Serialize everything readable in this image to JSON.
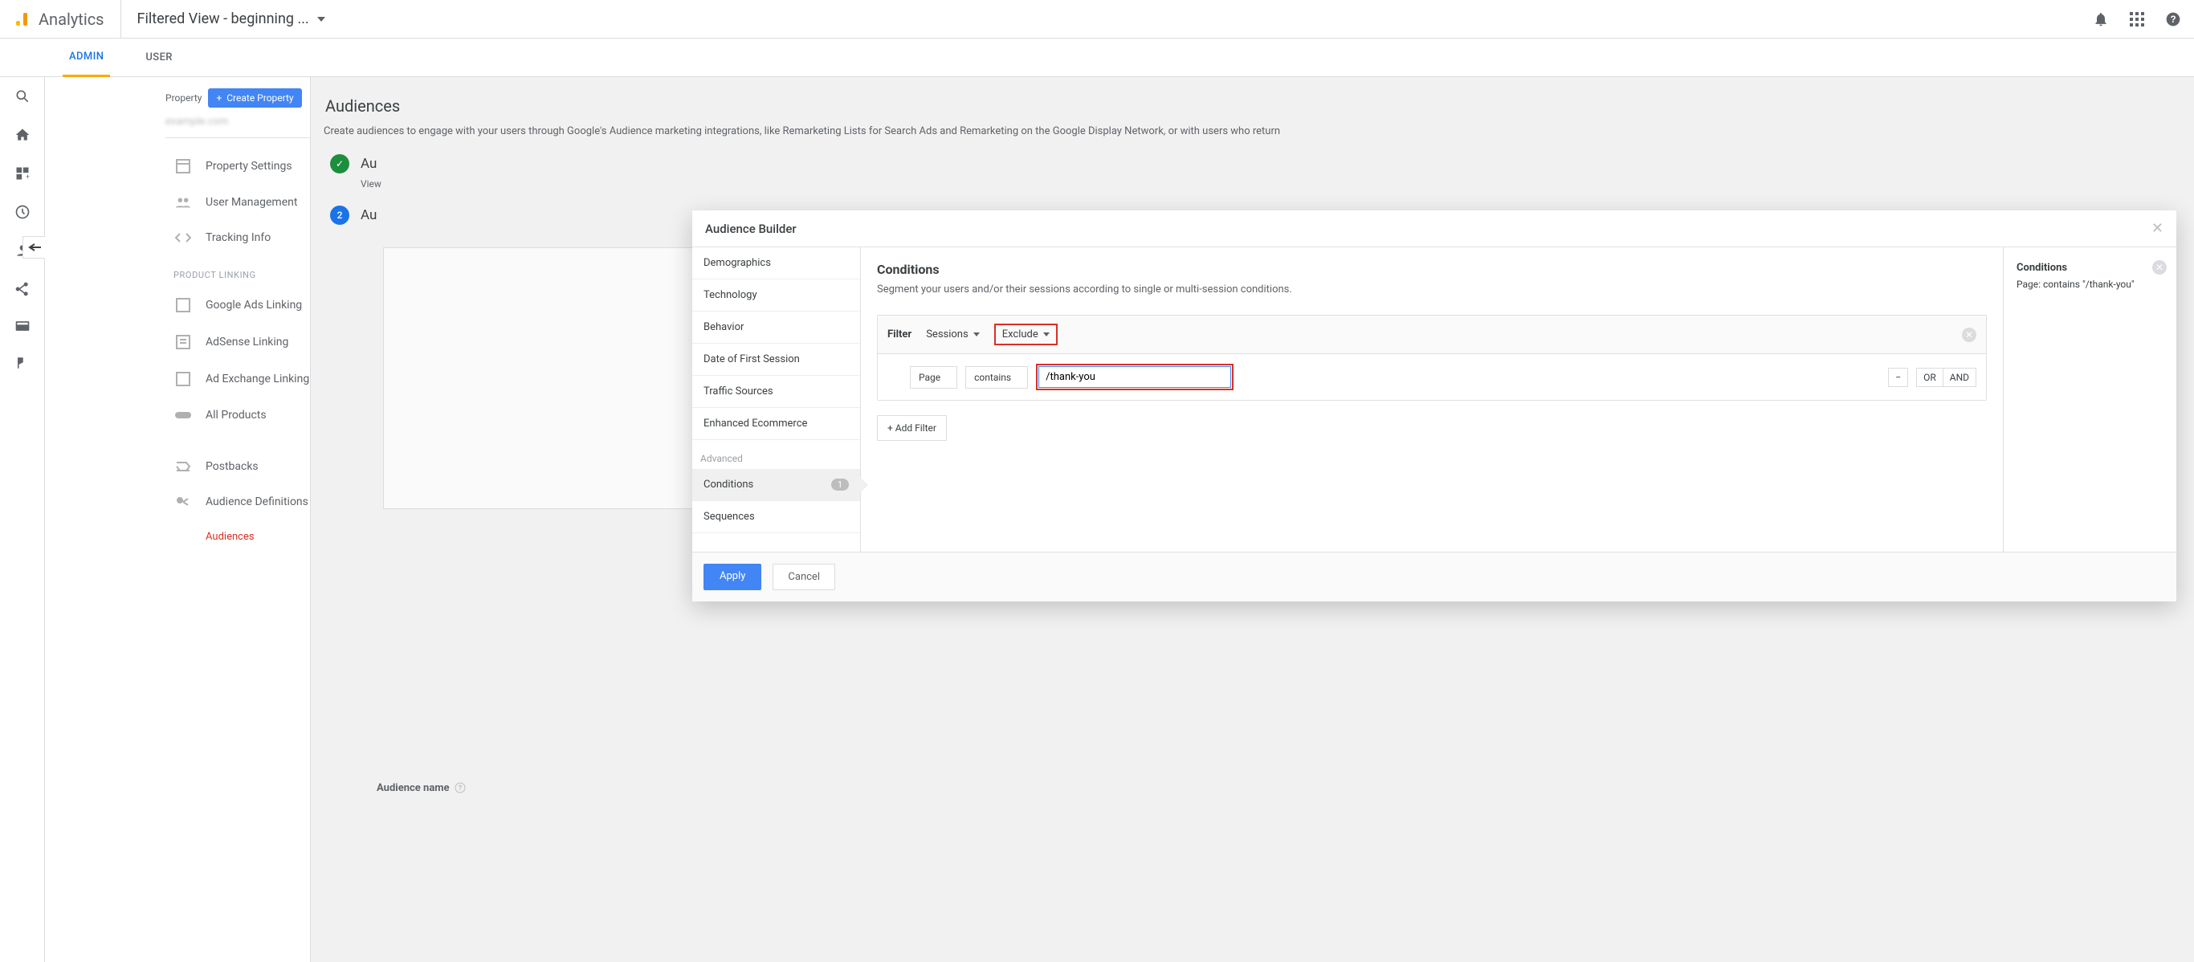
{
  "header": {
    "product": "Analytics",
    "view_title": "Filtered View - beginning ..."
  },
  "tabs": {
    "admin": "ADMIN",
    "user": "USER"
  },
  "property": {
    "label": "Property",
    "create_button": "Create Property",
    "name": "example.com"
  },
  "nav": {
    "property_settings": "Property Settings",
    "user_management": "User Management",
    "tracking_info": "Tracking Info",
    "section_product_linking": "PRODUCT LINKING",
    "google_ads_linking": "Google Ads Linking",
    "adsense_linking": "AdSense Linking",
    "ad_exchange_linking": "Ad Exchange Linking",
    "all_products": "All Products",
    "postbacks": "Postbacks",
    "audience_definitions": "Audience Definitions",
    "audiences_sub": "Audiences"
  },
  "main": {
    "title": "Audiences",
    "description": "Create audiences to engage with your users through Google's Audience marketing integrations, like Remarketing Lists for Search Ads and Remarketing on the Google Display Network, or with users who return",
    "step1": "Au",
    "step1_sub": "View",
    "step2": "Au",
    "audience_name_label": "Audience name"
  },
  "modal": {
    "title": "Audience Builder",
    "sidebar": {
      "demographics": "Demographics",
      "technology": "Technology",
      "behavior": "Behavior",
      "date_of_first_session": "Date of First Session",
      "traffic_sources": "Traffic Sources",
      "enhanced_ecommerce": "Enhanced Ecommerce",
      "advanced": "Advanced",
      "conditions": "Conditions",
      "conditions_count": "1",
      "sequences": "Sequences"
    },
    "center": {
      "heading": "Conditions",
      "subheading": "Segment your users and/or their sessions according to single or multi-session conditions.",
      "filter_label": "Filter",
      "sessions_label": "Sessions",
      "exclude_label": "Exclude",
      "page_label": "Page",
      "contains_label": "contains",
      "input_value": "/thank-you",
      "minus": "−",
      "or": "OR",
      "and": "AND",
      "add_filter": "+ Add Filter"
    },
    "right": {
      "heading": "Conditions",
      "detail": "Page: contains \"/thank-you\""
    },
    "footer": {
      "apply": "Apply",
      "cancel": "Cancel"
    }
  }
}
